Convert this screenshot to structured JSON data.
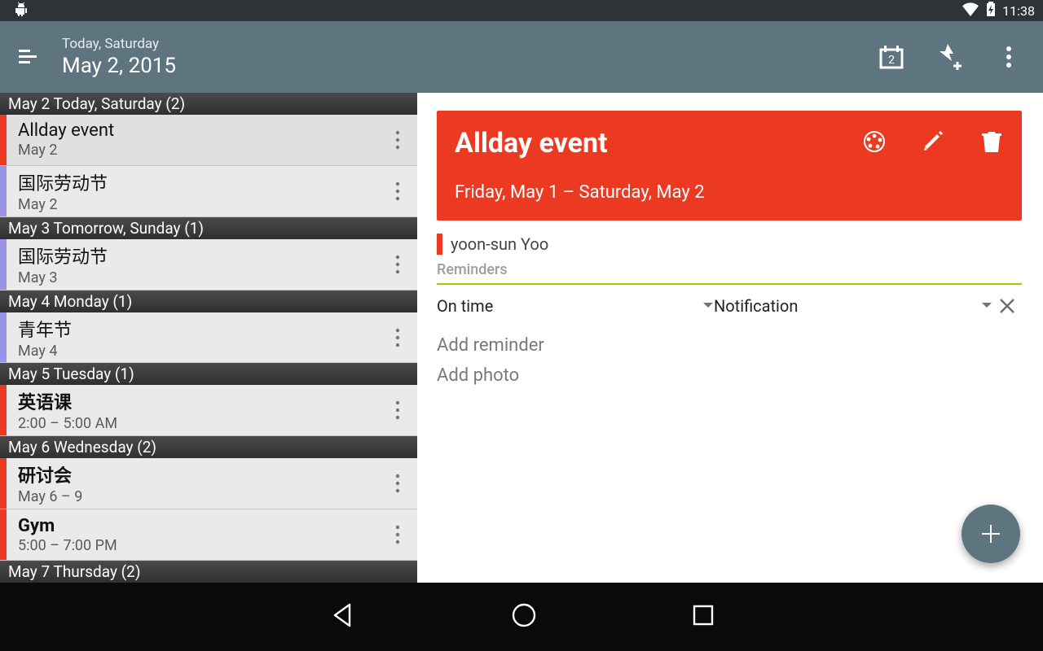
{
  "status": {
    "time": "11:38",
    "calendar_badge": "2"
  },
  "header": {
    "subtitle": "Today, Saturday",
    "title": "May 2, 2015"
  },
  "agenda": [
    {
      "type": "day",
      "label": "May 2 Today, Saturday (2)"
    },
    {
      "type": "event",
      "color": "#ec3921",
      "title": "Allday event",
      "time": "May 2",
      "selected": true
    },
    {
      "type": "event",
      "color": "#9b94e6",
      "title": "国际劳动节",
      "time": "May 2"
    },
    {
      "type": "day",
      "label": "May 3 Tomorrow, Sunday (1)"
    },
    {
      "type": "event",
      "color": "#9b94e6",
      "title": "国际劳动节",
      "time": "May 3"
    },
    {
      "type": "day",
      "label": "May 4 Monday (1)"
    },
    {
      "type": "event",
      "color": "#9b94e6",
      "title": "青年节",
      "time": "May 4"
    },
    {
      "type": "day",
      "label": "May 5 Tuesday (1)"
    },
    {
      "type": "event",
      "color": "#ec3921",
      "title": "英语课",
      "time": "2:00 – 5:00 AM",
      "bold": true
    },
    {
      "type": "day",
      "label": "May 6 Wednesday (2)"
    },
    {
      "type": "event",
      "color": "#ec3921",
      "title": "研讨会",
      "time": "May 6 – 9",
      "bold": true
    },
    {
      "type": "event",
      "color": "#ec3921",
      "title": "Gym",
      "time": "5:00 – 7:00 PM",
      "bold": true
    },
    {
      "type": "day",
      "label": "May 7 Thursday (2)"
    }
  ],
  "detail": {
    "title": "Allday event",
    "date_range": "Friday, May 1 – Saturday, May 2",
    "owner": "yoon-sun Yoo",
    "reminders_label": "Reminders",
    "reminder_time": "On time",
    "reminder_type": "Notification",
    "add_reminder": "Add reminder",
    "add_photo": "Add photo"
  }
}
